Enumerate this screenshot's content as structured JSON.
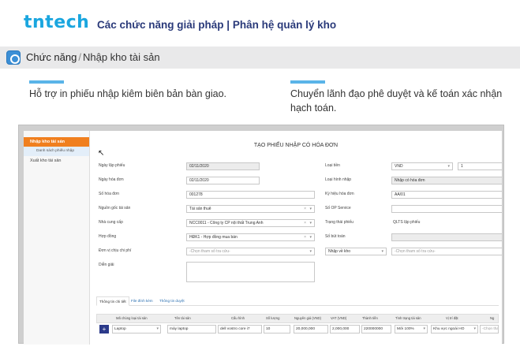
{
  "slide": {
    "logo": "tntech",
    "title": "Các chức năng giải pháp | Phân hệ quản lý kho",
    "crumb_parent": "Chức năng",
    "crumb_sep": "/",
    "crumb_current": "Nhập kho tài sản",
    "note_left": "Hỗ trợ in phiếu nhập kiêm biên bản bàn giao.",
    "note_right": "Chuyển lãnh đạo phê duyệt và kế toán xác nhận hạch toán."
  },
  "sidebar": {
    "items": [
      {
        "label": "Nhập kho tài sản",
        "active": true
      },
      {
        "label": "Danh sách phiếu nhập",
        "sub": true
      },
      {
        "label": "Xuất kho tài sản",
        "active": false
      }
    ]
  },
  "form": {
    "title": "TẠO PHIẾU NHẬP CÓ HÓA ĐƠN",
    "left": {
      "ngay_lap_label": "Ngày lập phiếu",
      "ngay_lap": "02/11/2020",
      "ngay_hd_label": "Ngày hóa đơn",
      "ngay_hd": "02/11/2020",
      "so_hd_label": "Số hóa đơn",
      "so_hd": "001278",
      "nguon_goc_label": "Nguồn gốc tài sản",
      "nguon_goc": "Tài sản thuê",
      "ncc_label": "Nhà cung cấp",
      "ncc": "NCC0011 - Công ty CP nội thất Trung Anh",
      "hop_dong_label": "Hợp đồng",
      "hop_dong": "HĐK1 - Hợp đồng mua bán",
      "don_vi_label": "Đơn vị chịu chi phí",
      "don_vi_ph": "-Chọn tham số tra cứu-",
      "dien_giai_label": "Diễn giải"
    },
    "right": {
      "loai_tien_label": "Loại tiền",
      "loai_tien": "VND",
      "ty_gia": "1",
      "loai_hinh_label": "Loại hình nhập",
      "loai_hinh": "Nhập có hóa đơn",
      "ky_hieu_label": "Ký hiệu hóa đơn",
      "ky_hieu": "AA/01",
      "so_op_label": "Số OP Service",
      "trang_thai_label": "Trạng thái phiếu",
      "trang_thai": "QLTS lập phiếu",
      "so_but_toan_label": "Số bút toán",
      "nhap_ve_kho_label": "Nhập về kho",
      "kho_ph": "-Chọn tham số tra cứu-"
    }
  },
  "tabs": [
    {
      "label": "Thông tin chi tiết",
      "active": true
    },
    {
      "label": "File đính kèm",
      "active": false
    },
    {
      "label": "Thông tin duyệt",
      "active": false
    }
  ],
  "table": {
    "headers": [
      "Mã chủng loại tài sản",
      "Tên tài sản",
      "Cấu hình",
      "Số lượng",
      "Nguyên giá (VND)",
      "VAT (VND)",
      "Thành tiền",
      "Tình trạng tài sản",
      "Vị trí đặt",
      "Ng"
    ],
    "row": {
      "loai": "Laptop",
      "ten": "máy laptop",
      "cau_hinh": "dell vostro core i7",
      "so_luong": "10",
      "nguyen_gia": "20,000,000",
      "vat": "2,000,000",
      "thanh_tien": "220000000",
      "tinh_trang": "Mới 100%",
      "vi_tri": "Khu vực ngoài HO",
      "ng": "-Chọn tha"
    }
  }
}
